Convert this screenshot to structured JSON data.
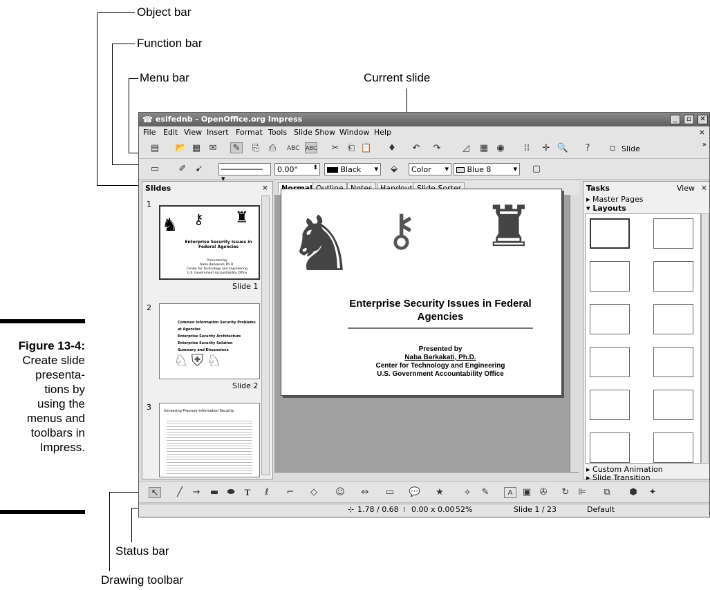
{
  "callouts": {
    "object_bar": "Object bar",
    "function_bar": "Function bar",
    "menu_bar": "Menu bar",
    "current_slide": "Current slide",
    "status_bar": "Status bar",
    "drawing_toolbar": "Drawing toolbar"
  },
  "figure": {
    "label": "Figure 13-4:",
    "caption_lines": [
      "Create slide",
      "presenta-",
      "tions by",
      "using the",
      "menus and",
      "toolbars in",
      "Impress."
    ]
  },
  "window": {
    "title": "esifednb - OpenOffice.org Impress",
    "menus": [
      "File",
      "Edit",
      "View",
      "Insert",
      "Format",
      "Tools",
      "Slide Show",
      "Window",
      "Help"
    ],
    "function_bar": {
      "slide_button": "Slide"
    },
    "object_bar": {
      "position_value": "0.00\"",
      "line_color": "Black",
      "fill_type": "Color",
      "fill_color": "Blue 8"
    }
  },
  "slides_pane": {
    "title": "Slides",
    "items": [
      {
        "number": "1",
        "label": "Slide 1",
        "title": "Enterprise Security Issues in Federal Agencies",
        "presenter": [
          "Presented by",
          "Naba Barkakati, Ph.D.",
          "Center for Technology and Engineering",
          "U.S. Government Accountability Office"
        ]
      },
      {
        "number": "2",
        "label": "Slide 2",
        "bullets": [
          "Common Information Security Problems at Agencies",
          "Enterprise Security Architecture",
          "Enterprise Security Solution",
          "Summary and Discussions"
        ]
      },
      {
        "number": "3",
        "heading": "Increasing Pressure Information Security"
      }
    ]
  },
  "view_tabs": [
    "Normal",
    "Outline",
    "Notes",
    "Handout",
    "Slide Sorter"
  ],
  "current_slide": {
    "title_line1": "Enterprise Security Issues in Federal",
    "title_line2": "Agencies",
    "presented_by": "Presented by",
    "presenter": "Naba Barkakati, Ph.D.",
    "org_line1": "Center for Technology and Engineering",
    "org_line2": "U.S. Government Accountability Office"
  },
  "tasks_pane": {
    "title": "Tasks",
    "view_label": "View",
    "sections": [
      "Master Pages",
      "Layouts",
      "Custom Animation",
      "Slide Transition"
    ]
  },
  "status_bar": {
    "position": "1.78 / 0.68",
    "size": "0.00 x 0.00",
    "zoom": "52%",
    "slide": "Slide 1 / 23",
    "layout": "Default"
  }
}
